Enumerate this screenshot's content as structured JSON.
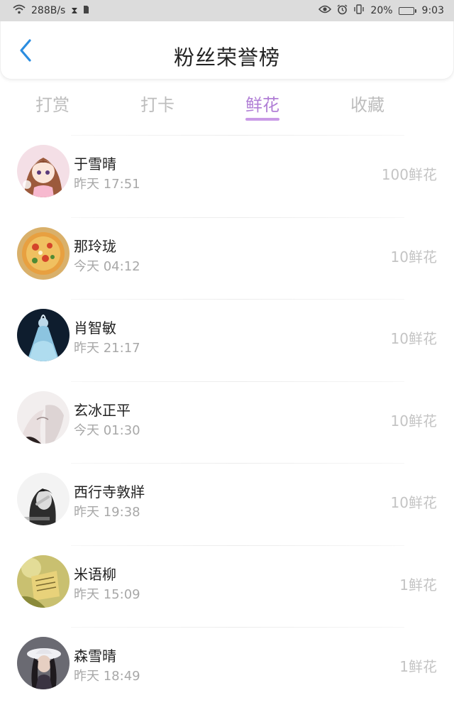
{
  "status_bar": {
    "network_speed": "288B/s",
    "battery_percent": "20%",
    "time": "9:03",
    "battery_level": 0.2,
    "icons": [
      "wifi-icon",
      "hourglass-icon",
      "sim-icon",
      "eye-icon",
      "alarm-icon",
      "vibrate-icon",
      "battery-icon"
    ]
  },
  "header": {
    "title": "粉丝荣誉榜",
    "back_icon": "chevron-left-icon",
    "accent_color": "#2b8de0"
  },
  "tabs": [
    {
      "label": "打赏",
      "active": false
    },
    {
      "label": "打卡",
      "active": false
    },
    {
      "label": "鲜花",
      "active": true
    },
    {
      "label": "收藏",
      "active": false
    }
  ],
  "active_color": "#b17fd6",
  "fans": [
    {
      "name": "于雪晴",
      "time": "昨天 17:51",
      "amount": "100鲜花",
      "avatar": "anime-girl-avatar"
    },
    {
      "name": "那玲珑",
      "time": "今天 04:12",
      "amount": "10鲜花",
      "avatar": "pizza-avatar"
    },
    {
      "name": "肖智敏",
      "time": "昨天 21:17",
      "amount": "10鲜花",
      "avatar": "blue-gown-avatar"
    },
    {
      "name": "玄冰正平",
      "time": "今天 01:30",
      "amount": "10鲜花",
      "avatar": "sketch-couple-avatar"
    },
    {
      "name": "西行寺敦牂",
      "time": "昨天 19:38",
      "amount": "10鲜花",
      "avatar": "monochrome-girl-avatar"
    },
    {
      "name": "米语柳",
      "time": "昨天 15:09",
      "amount": "1鲜花",
      "avatar": "yellow-note-avatar"
    },
    {
      "name": "森雪晴",
      "time": "昨天 18:49",
      "amount": "1鲜花",
      "avatar": "girl-with-hat-avatar"
    }
  ]
}
